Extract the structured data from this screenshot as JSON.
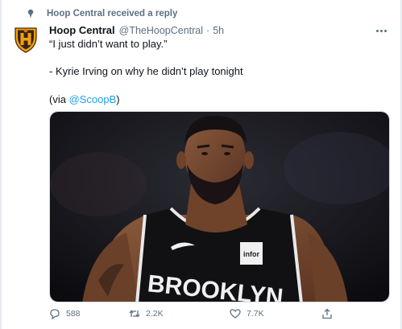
{
  "context": {
    "text": "Hoop Central received a reply",
    "icon": "pin-icon"
  },
  "author": {
    "name": "Hoop Central",
    "handle": "@TheHoopCentral",
    "separator": "·",
    "time": "5h"
  },
  "tweet": {
    "quote": "“I just didn’t want to play.”",
    "attribution": "- Kyrie Irving on why he didn’t play tonight",
    "via_prefix": "(via ",
    "via_mention": "@ScoopB",
    "via_suffix": ")"
  },
  "media": {
    "jersey_text": "BROOKLYN",
    "sponsor_patch": "infor"
  },
  "actions": {
    "replies": "588",
    "retweets": "2.2K",
    "likes": "7.7K"
  },
  "colors": {
    "accent": "#1da1f2",
    "secondary_text": "#5b7083",
    "text": "#0f1419"
  }
}
